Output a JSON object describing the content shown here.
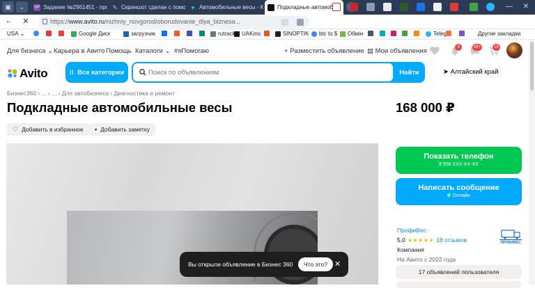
{
  "browser": {
    "tabs": [
      {
        "title": "Задание №2961451 - прос",
        "favicon_text": "SP",
        "favicon_color": "#7a4b9e"
      },
      {
        "title": "Скриншот сделан с помо",
        "favicon_text": "",
        "favicon_color": "#8b5cf6"
      },
      {
        "title": "Автомобильные весы - К",
        "favicon_text": "",
        "favicon_color": "#2ec27e"
      },
      {
        "title": "Подкладные автомоби",
        "favicon_text": "",
        "favicon_color": "#111111",
        "active": true
      }
    ],
    "url_prefix": "https://",
    "url_host": "www.avito.ru",
    "url_path": "/nizhniy_novgorod/oborudovanie_dlya_biznesa...",
    "bookmarks": [
      "USA",
      "Google Диск",
      "загрузчик",
      "rutracker",
      "UAKino",
      "SINOPTIK",
      "btc to $",
      "Обмін",
      "Telegr",
      "Другие закладки"
    ]
  },
  "nav": {
    "business": "Для бизнеса",
    "career": "Карьера в Авито",
    "help": "Помощь",
    "catalogs": "Каталоги",
    "help_tag": "#яПомогаю",
    "post_ad": "+ Разместить объявление",
    "my_ads": "Мои объявления",
    "badge_notify": "9",
    "badge_messages": "99+",
    "badge_cart": "15"
  },
  "search": {
    "logo": "Avito",
    "categories": "Все категории",
    "placeholder": "Поиск по объявлениям",
    "find": "Найти",
    "region": "Алтайский край"
  },
  "listing": {
    "breadcrumbs": "Бизнес360  ›  ...  ›  ...  ›  Для автобизнеса  ›  Диагностика и ремонт",
    "title": "Подкладные автомобильные весы",
    "price": "168 000 ₽",
    "add_favorite": "Добавить в избранное",
    "add_note": "Добавить заметку"
  },
  "toast": {
    "message": "Вы открыли объявление в Бизнес 360",
    "what_button": "Что это?"
  },
  "sidebar": {
    "show_phone": "Показать телефон",
    "phone_masked": "8 958 XXX-XX-XX",
    "write_message": "Написать сообщение",
    "online": "Онлайн",
    "seller_name": "ПрофиВес",
    "rating": "5,0",
    "stars": "★★★★★",
    "reviews": "18 отзывов",
    "seller_type": "Компания",
    "since": "На Авито с 2022 года",
    "logo_text": "ПРОФИВЕС",
    "all_ads": "17 объявлений пользователя"
  },
  "colors": {
    "avito_blue": "#00aaff",
    "avito_green": "#00c853",
    "tab_bar": "#2b3a55"
  }
}
